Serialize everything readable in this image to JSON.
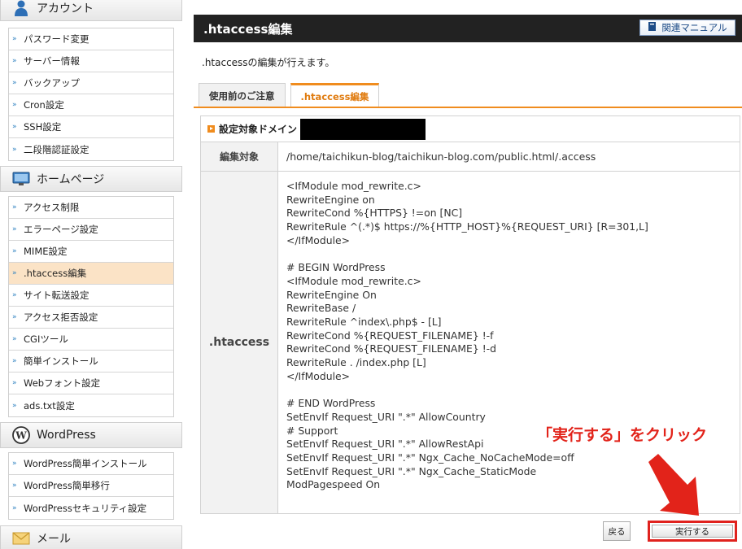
{
  "sidebar": {
    "sections": [
      {
        "title": "アカウント",
        "icon": "user-icon",
        "items": [
          "パスワード変更",
          "サーバー情報",
          "バックアップ",
          "Cron設定",
          "SSH設定",
          "二段階認証設定"
        ]
      },
      {
        "title": "ホームページ",
        "icon": "monitor-icon",
        "items": [
          "アクセス制限",
          "エラーページ設定",
          "MIME設定",
          ".htaccess編集",
          "サイト転送設定",
          "アクセス拒否設定",
          "CGIツール",
          "簡単インストール",
          "Webフォント設定",
          "ads.txt設定"
        ]
      },
      {
        "title": "WordPress",
        "icon": "wordpress-icon",
        "items": [
          "WordPress簡単インストール",
          "WordPress簡単移行",
          "WordPressセキュリティ設定"
        ]
      },
      {
        "title": "メール",
        "icon": "mail-icon",
        "items": []
      }
    ],
    "active_item": ".htaccess編集"
  },
  "header": {
    "title": ".htaccess編集",
    "manual_label": "関連マニュアル"
  },
  "description": ".htaccessの編集が行えます。",
  "tabs": [
    {
      "label": "使用前のご注意",
      "active": false
    },
    {
      "label": ".htaccess編集",
      "active": true
    }
  ],
  "panel": {
    "domain_label": "設定対象ドメイン",
    "target_label": "編集対象",
    "target_path": "/home/taichikun-blog/taichikun-blog.com/public.html/.access",
    "editor_label": ".htaccess",
    "editor_content": "<IfModule mod_rewrite.c>\nRewriteEngine on\nRewriteCond %{HTTPS} !=on [NC]\nRewriteRule ^(.*)$ https://%{HTTP_HOST}%{REQUEST_URI} [R=301,L]\n</IfModule>\n\n# BEGIN WordPress\n<IfModule mod_rewrite.c>\nRewriteEngine On\nRewriteBase /\nRewriteRule ^index\\.php$ - [L]\nRewriteCond %{REQUEST_FILENAME} !-f\nRewriteCond %{REQUEST_FILENAME} !-d\nRewriteRule . /index.php [L]\n</IfModule>\n\n# END WordPress\nSetEnvIf Request_URI \".*\" AllowCountry\n# Support\nSetEnvIf Request_URI \".*\" AllowRestApi\nSetEnvIf Request_URI \".*\" Ngx_Cache_NoCacheMode=off\nSetEnvIf Request_URI \".*\" Ngx_Cache_StaticMode\nModPagespeed On"
  },
  "buttons": {
    "back": "戻る",
    "execute": "実行する"
  },
  "annotation": {
    "text": "「実行する」をクリック"
  },
  "colors": {
    "accent": "#f08c1e",
    "annotation_red": "#e2231a",
    "title_bar": "#222222"
  }
}
